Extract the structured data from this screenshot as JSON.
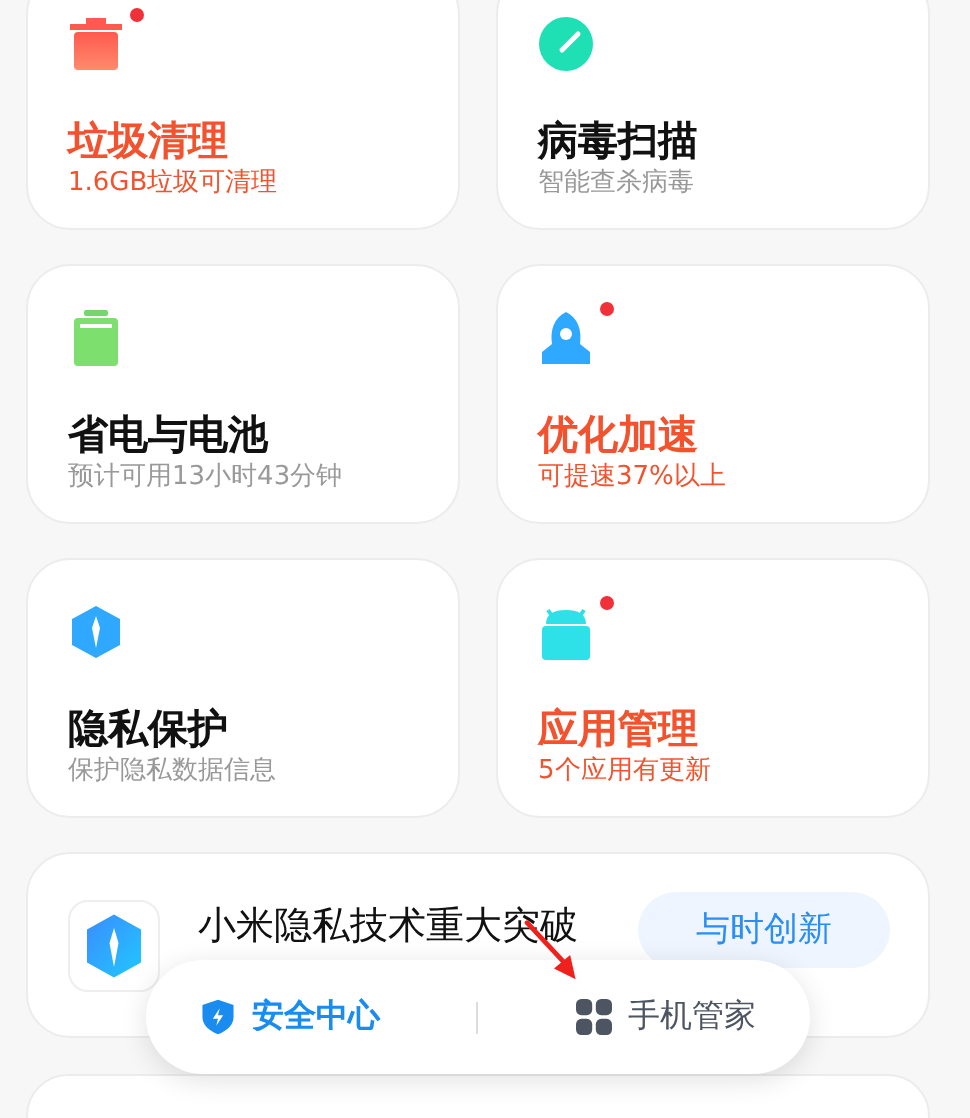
{
  "cards": [
    {
      "kind": "trash",
      "title": "垃圾清理",
      "subtitle": "1.6GB垃圾可清理",
      "alert": true,
      "dot": true
    },
    {
      "kind": "scan",
      "title": "病毒扫描",
      "subtitle": "智能查杀病毒",
      "alert": false,
      "dot": false
    },
    {
      "kind": "battery",
      "title": "省电与电池",
      "subtitle": "预计可用13小时43分钟",
      "alert": false,
      "dot": false
    },
    {
      "kind": "rocket",
      "title": "优化加速",
      "subtitle": "可提速37%以上",
      "alert": true,
      "dot": true
    },
    {
      "kind": "privacy",
      "title": "隐私保护",
      "subtitle": "保护隐私数据信息",
      "alert": false,
      "dot": false
    },
    {
      "kind": "apps",
      "title": "应用管理",
      "subtitle": "5个应用有更新",
      "alert": true,
      "dot": true
    }
  ],
  "banner": {
    "title": "小米隐私技术重大突破",
    "button": "与时创新"
  },
  "bottom_nav": [
    {
      "kind": "shield",
      "label": "安全中心",
      "selected": true
    },
    {
      "kind": "grid",
      "label": "手机管家",
      "selected": false
    }
  ]
}
